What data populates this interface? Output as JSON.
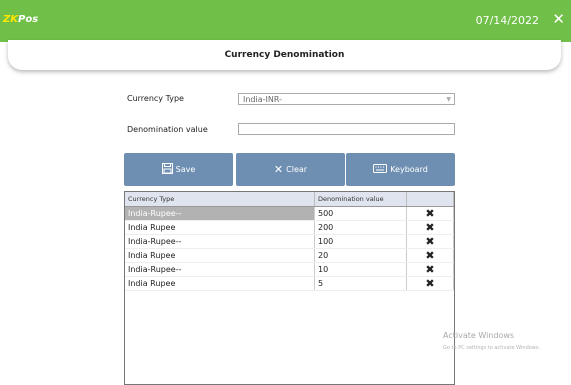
{
  "app": {
    "logo_prefix": "ZK",
    "logo_suffix": "Pos",
    "date": "07/14/2022",
    "close_glyph": "✕",
    "colors": {
      "titlebar": "#6fbf48",
      "button": "#6f8fb2",
      "selected_row": "#b2b2b2"
    }
  },
  "page": {
    "title": "Currency Denomination"
  },
  "form": {
    "currency_type_label": "Currency Type",
    "currency_type_value": "India-INR-",
    "denomination_label": "Denomination value",
    "denomination_value": ""
  },
  "buttons": {
    "save": {
      "label": "Save",
      "icon": "save-icon"
    },
    "clear": {
      "label": "Clear",
      "icon": "clear-icon"
    },
    "keyboard": {
      "label": "Keyboard",
      "icon": "keyboard-icon"
    }
  },
  "grid": {
    "headers": [
      "Currency Type",
      "Denomination value",
      ""
    ],
    "rows": [
      {
        "currency": "India-Rupee--",
        "value": "500",
        "delete": "✖",
        "selected": true
      },
      {
        "currency": "India Rupee",
        "value": "200",
        "delete": "✖",
        "selected": false
      },
      {
        "currency": "India-Rupee--",
        "value": "100",
        "delete": "✖",
        "selected": false
      },
      {
        "currency": "India Rupee",
        "value": "20",
        "delete": "✖",
        "selected": false
      },
      {
        "currency": "India-Rupee--",
        "value": "10",
        "delete": "✖",
        "selected": false
      },
      {
        "currency": "India Rupee",
        "value": "5",
        "delete": "✖",
        "selected": false
      }
    ]
  },
  "watermark": {
    "line1": "Activate Windows",
    "line2": "Go to PC settings to activate Windows."
  }
}
